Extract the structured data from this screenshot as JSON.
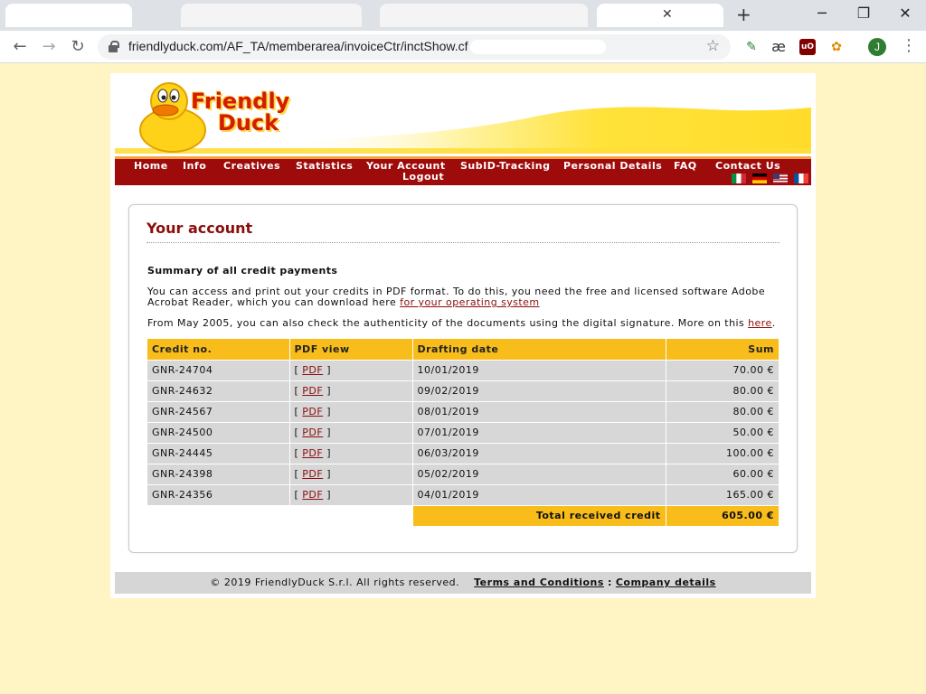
{
  "browser": {
    "url": "friendlyduck.com/AF_TA/memberarea/invoiceCtr/inctShow.cf",
    "avatar_letter": "J",
    "new_tab": "+",
    "ext_ae": "æ"
  },
  "site": {
    "logo_line1": "Friendly",
    "logo_line2": "Duck"
  },
  "nav": {
    "home": "Home",
    "info": "Info",
    "creatives": "Creatives",
    "statistics": "Statistics",
    "your_account": "Your Account",
    "logout": "Logout",
    "subid": "SubID-Tracking",
    "personal": "Personal Details",
    "faq": "FAQ",
    "contact": "Contact Us"
  },
  "account": {
    "title": "Your account",
    "subtitle": "Summary of all credit payments",
    "para1": "You can access and print out your credits in PDF format. To do this, you need the free and licensed software Adobe Acrobat Reader, which you can download here ",
    "para1_link": "for your operating system",
    "para2": "From May 2005, you can also check the authenticity of the documents using the digital signature. More on this ",
    "para2_link": "here",
    "para2_end": "."
  },
  "table": {
    "headers": {
      "credit_no": "Credit no.",
      "pdf_view": "PDF view",
      "date": "Drafting date",
      "sum": "Sum"
    },
    "pdf_label": "PDF",
    "rows": [
      {
        "credit": "GNR-24704",
        "date": "10/01/2019",
        "sum": "70.00 €"
      },
      {
        "credit": "GNR-24632",
        "date": "09/02/2019",
        "sum": "80.00 €"
      },
      {
        "credit": "GNR-24567",
        "date": "08/01/2019",
        "sum": "80.00 €"
      },
      {
        "credit": "GNR-24500",
        "date": "07/01/2019",
        "sum": "50.00 €"
      },
      {
        "credit": "GNR-24445",
        "date": "06/03/2019",
        "sum": "100.00 €"
      },
      {
        "credit": "GNR-24398",
        "date": "05/02/2019",
        "sum": "60.00 €"
      },
      {
        "credit": "GNR-24356",
        "date": "04/01/2019",
        "sum": "165.00 €"
      }
    ],
    "total_label": "Total received credit",
    "total_value": "605.00 €"
  },
  "footer": {
    "copyright": "© 2019 FriendlyDuck S.r.l. All rights reserved.",
    "terms": "Terms and Conditions",
    "separator": ":",
    "company": "Company details"
  }
}
